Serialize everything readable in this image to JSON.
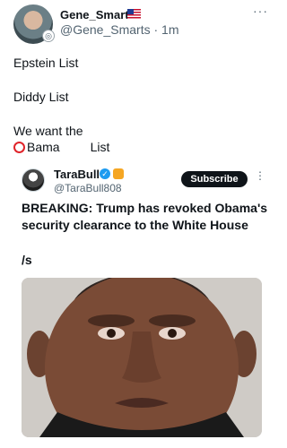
{
  "post": {
    "display_name": "Gene_Smarts",
    "handle": "@Gene_Smarts",
    "time": "· 1m",
    "more": "···",
    "text_lines": [
      "Epstein List",
      "Diddy List",
      "We want the"
    ],
    "obama": "Bama",
    "list_word": "List"
  },
  "quote": {
    "display_name": "TaraBull",
    "handle": "@TaraBull808",
    "subscribe": "Subscribe",
    "more": "⋮",
    "headline": "BREAKING: Trump has revoked Obama's security clearance to the White House",
    "tag": "/s"
  },
  "colors": {
    "accent": "#1d9bf0",
    "circle": "#e0242a"
  }
}
